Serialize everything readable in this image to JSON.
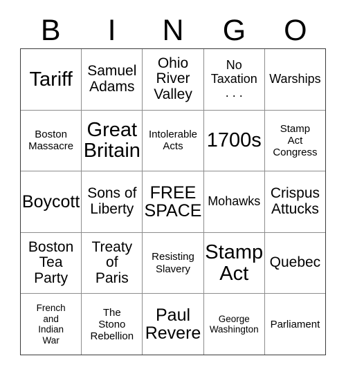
{
  "card": {
    "header_letters": [
      "B",
      "I",
      "N",
      "G",
      "O"
    ],
    "rows": [
      [
        {
          "text": "Tariff",
          "size": "xxl"
        },
        {
          "text": "Samuel\nAdams",
          "size": "l"
        },
        {
          "text": "Ohio\nRiver\nValley",
          "size": "l"
        },
        {
          "text": "No\nTaxation\n. . .",
          "size": "m"
        },
        {
          "text": "Warships",
          "size": "m"
        }
      ],
      [
        {
          "text": "Boston\nMassacre",
          "size": "s"
        },
        {
          "text": "Great\nBritain",
          "size": "xxl"
        },
        {
          "text": "Intolerable\nActs",
          "size": "s"
        },
        {
          "text": "1700s",
          "size": "xxl"
        },
        {
          "text": "Stamp\nAct\nCongress",
          "size": "s"
        }
      ],
      [
        {
          "text": "Boycott",
          "size": "xl"
        },
        {
          "text": "Sons of\nLiberty",
          "size": "l"
        },
        {
          "text": "FREE\nSPACE",
          "size": "xl"
        },
        {
          "text": "Mohawks",
          "size": "m"
        },
        {
          "text": "Crispus\nAttucks",
          "size": "l"
        }
      ],
      [
        {
          "text": "Boston\nTea\nParty",
          "size": "l"
        },
        {
          "text": "Treaty\nof\nParis",
          "size": "l"
        },
        {
          "text": "Resisting\nSlavery",
          "size": "s"
        },
        {
          "text": "Stamp\nAct",
          "size": "xxl"
        },
        {
          "text": "Quebec",
          "size": "l"
        }
      ],
      [
        {
          "text": "French\nand\nIndian\nWar",
          "size": "xs"
        },
        {
          "text": "The\nStono\nRebellion",
          "size": "s"
        },
        {
          "text": "Paul\nRevere",
          "size": "xl"
        },
        {
          "text": "George\nWashington",
          "size": "xs"
        },
        {
          "text": "Parliament",
          "size": "s"
        }
      ]
    ]
  }
}
